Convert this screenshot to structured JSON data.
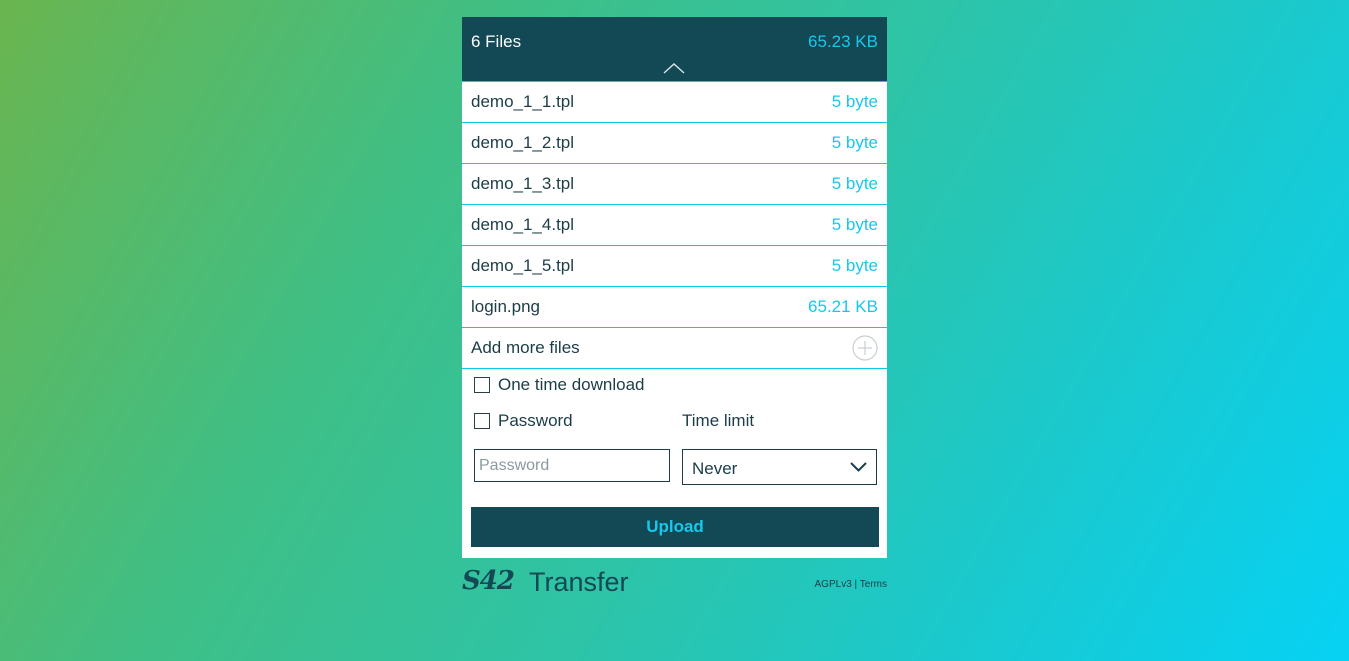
{
  "header": {
    "file_count": "6 Files",
    "total_size": "65.23 KB",
    "collapse_icon": "chevron-up-icon"
  },
  "files": [
    {
      "name": "demo_1_1.tpl",
      "size": "5 byte"
    },
    {
      "name": "demo_1_2.tpl",
      "size": "5 byte"
    },
    {
      "name": "demo_1_3.tpl",
      "size": "5 byte"
    },
    {
      "name": "demo_1_4.tpl",
      "size": "5 byte"
    },
    {
      "name": "demo_1_5.tpl",
      "size": "5 byte"
    },
    {
      "name": "login.png",
      "size": "65.21 KB"
    }
  ],
  "add_more": {
    "label": "Add more files",
    "icon": "plus-circle-icon"
  },
  "options": {
    "one_time_download": {
      "label": "One time download",
      "checked": false
    },
    "password": {
      "label": "Password",
      "checked": false
    },
    "password_field": {
      "placeholder": "Password",
      "value": ""
    },
    "time_limit": {
      "label": "Time limit",
      "selected": "Never"
    }
  },
  "upload_button": "Upload",
  "brand": {
    "logo_mark": "S42",
    "logo_word": "Transfer"
  },
  "footer": {
    "license": "AGPLv3",
    "separator": "|",
    "terms": "Terms"
  },
  "colors": {
    "dark_teal": "#134855",
    "accent_cyan": "#17c8ec",
    "text": "#1c3d47"
  }
}
